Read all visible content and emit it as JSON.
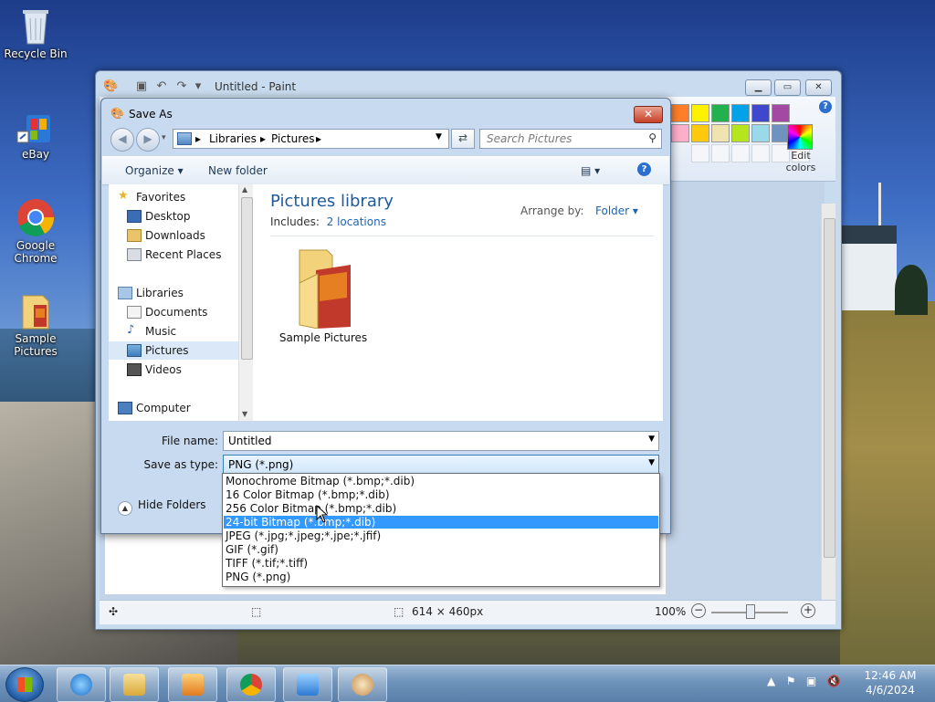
{
  "desktop": {
    "icons": [
      {
        "label": "Recycle Bin"
      },
      {
        "label": "eBay"
      },
      {
        "label": "Google Chrome"
      },
      {
        "label": "Sample Pictures"
      }
    ]
  },
  "paint": {
    "title": "Untitled - Paint",
    "edit_colors_label": "Edit colors",
    "status": {
      "dimensions": "614 × 460px",
      "zoom": "100%"
    },
    "palette": [
      "#ff7f27",
      "#fff200",
      "#22b14c",
      "#00a2e8",
      "#3f48cc",
      "#a349a4",
      "#ffaec9",
      "#ffc90e",
      "#efe4b0",
      "#b5e61d",
      "#99d9ea",
      "#7092be",
      "#c8bfe7"
    ]
  },
  "dialog": {
    "title": "Save As",
    "address": {
      "parts": [
        "Libraries",
        "Pictures"
      ]
    },
    "search_placeholder": "Search Pictures",
    "toolbar": {
      "organize": "Organize",
      "new_folder": "New folder"
    },
    "nav": [
      {
        "label": "Favorites"
      },
      {
        "label": "Desktop"
      },
      {
        "label": "Downloads"
      },
      {
        "label": "Recent Places"
      },
      {
        "label": "Libraries"
      },
      {
        "label": "Documents"
      },
      {
        "label": "Music"
      },
      {
        "label": "Pictures"
      },
      {
        "label": "Videos"
      },
      {
        "label": "Computer"
      }
    ],
    "library": {
      "title": "Pictures library",
      "includes_label": "Includes:",
      "locations": "2 locations",
      "arrange_by": "Arrange by:",
      "arrange_value": "Folder"
    },
    "folder_name": "Sample Pictures",
    "file_name_label": "File name:",
    "file_name_value": "Untitled",
    "save_type_label": "Save as type:",
    "save_type_value": "PNG (*.png)",
    "hide_folders": "Hide Folders",
    "type_options": [
      "Monochrome Bitmap (*.bmp;*.dib)",
      "16 Color Bitmap (*.bmp;*.dib)",
      "256 Color Bitmap (*.bmp;*.dib)",
      "24-bit Bitmap (*.bmp;*.dib)",
      "JPEG (*.jpg;*.jpeg;*.jpe;*.jfif)",
      "GIF (*.gif)",
      "TIFF (*.tif;*.tiff)",
      "PNG (*.png)"
    ],
    "highlighted_option": "24-bit Bitmap (*.bmp;*.dib)"
  },
  "taskbar": {
    "time": "12:46 AM",
    "date": "4/6/2024"
  }
}
